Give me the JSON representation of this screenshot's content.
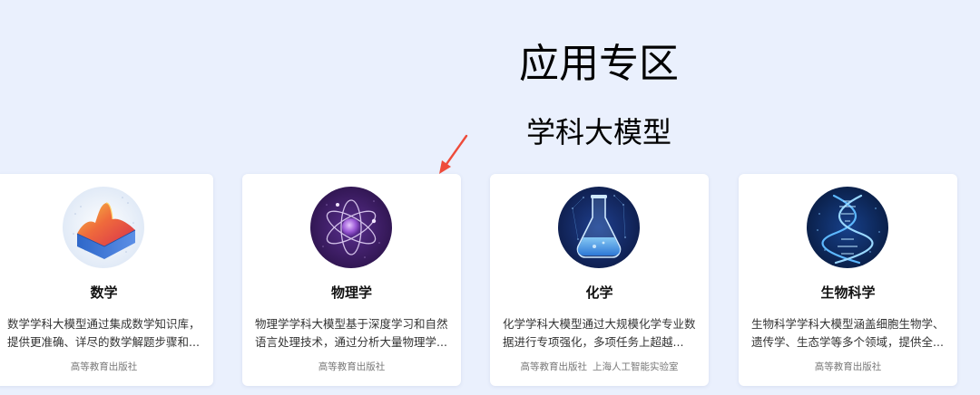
{
  "page": {
    "title": "应用专区",
    "section_title": "学科大模型"
  },
  "colors": {
    "background": "#eaf0fd",
    "card_background": "#ffffff",
    "arrow": "#ee4b3a"
  },
  "cards": [
    {
      "title": "数学",
      "description": "数学学科大模型通过集成数学知识库，提供更准确、详尽的数学解题步骤和...",
      "publishers": [
        "高等教育出版社"
      ],
      "icon": "math-surface-icon"
    },
    {
      "title": "物理学",
      "description": "物理学学科大模型基于深度学习和自然语言处理技术，通过分析大量物理学...",
      "publishers": [
        "高等教育出版社"
      ],
      "icon": "atom-icon"
    },
    {
      "title": "化学",
      "description": "化学学科大模型通过大规模化学专业数据进行专项强化，多项任务上超越...",
      "publishers": [
        "高等教育出版社",
        "上海人工智能实验室"
      ],
      "icon": "flask-icon"
    },
    {
      "title": "生物科学",
      "description": "生物科学学科大模型涵盖细胞生物学、遗传学、生态学等多个领域，提供全...",
      "publishers": [
        "高等教育出版社"
      ],
      "icon": "dna-icon"
    }
  ]
}
